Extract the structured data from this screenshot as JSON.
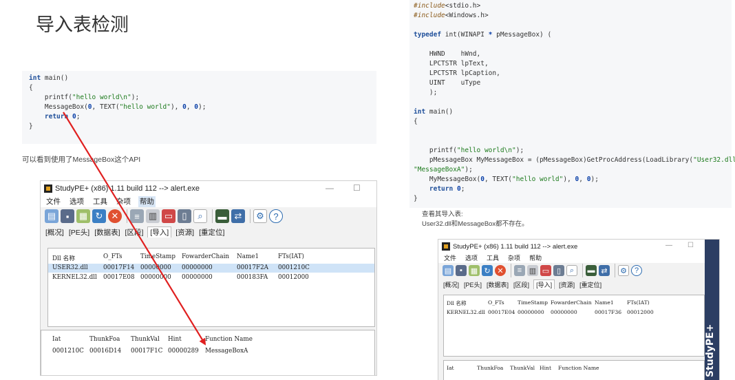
{
  "page_title": "导入表检测",
  "left_code": {
    "lines": [
      [
        {
          "t": "int",
          "c": "kw"
        },
        {
          "t": " main()",
          "c": ""
        }
      ],
      [
        {
          "t": "{",
          "c": ""
        }
      ],
      [
        {
          "t": "    printf(",
          "c": ""
        },
        {
          "t": "\"hello world\\n\"",
          "c": "str"
        },
        {
          "t": ");",
          "c": ""
        }
      ],
      [
        {
          "t": "    MessageBox(",
          "c": ""
        },
        {
          "t": "0",
          "c": "num"
        },
        {
          "t": ", TEXT(",
          "c": ""
        },
        {
          "t": "\"hello world\"",
          "c": "str"
        },
        {
          "t": "), ",
          "c": ""
        },
        {
          "t": "0",
          "c": "num"
        },
        {
          "t": ", ",
          "c": ""
        },
        {
          "t": "0",
          "c": "num"
        },
        {
          "t": ");",
          "c": ""
        }
      ],
      [
        {
          "t": "    ",
          "c": ""
        },
        {
          "t": "return",
          "c": "kw"
        },
        {
          "t": " ",
          "c": ""
        },
        {
          "t": "0",
          "c": "num"
        },
        {
          "t": ";",
          "c": ""
        }
      ],
      [
        {
          "t": "}",
          "c": ""
        }
      ]
    ]
  },
  "left_caption": "可以看到使用了MessageBox这个API",
  "right_code": {
    "lines": [
      [
        {
          "t": "#include",
          "c": "pp"
        },
        {
          "t": "<stdio.h>",
          "c": ""
        }
      ],
      [
        {
          "t": "#include",
          "c": "pp"
        },
        {
          "t": "<Windows.h>",
          "c": ""
        }
      ],
      [
        {
          "t": "",
          "c": ""
        }
      ],
      [
        {
          "t": "typedef",
          "c": "kw"
        },
        {
          "t": " int(WINAPI ",
          "c": ""
        },
        {
          "t": "*",
          "c": "num"
        },
        {
          "t": " pMessageBox) (",
          "c": ""
        }
      ],
      [
        {
          "t": "",
          "c": ""
        }
      ],
      [
        {
          "t": "    HWND    hWnd,",
          "c": ""
        }
      ],
      [
        {
          "t": "    LPCTSTR lpText,",
          "c": ""
        }
      ],
      [
        {
          "t": "    LPCTSTR lpCaption,",
          "c": ""
        }
      ],
      [
        {
          "t": "    UINT    uType",
          "c": ""
        }
      ],
      [
        {
          "t": "    );",
          "c": ""
        }
      ],
      [
        {
          "t": "",
          "c": ""
        }
      ],
      [
        {
          "t": "int",
          "c": "kw"
        },
        {
          "t": " main()",
          "c": ""
        }
      ],
      [
        {
          "t": "{",
          "c": ""
        }
      ],
      [
        {
          "t": "",
          "c": ""
        }
      ],
      [
        {
          "t": "",
          "c": ""
        }
      ],
      [
        {
          "t": "    printf(",
          "c": ""
        },
        {
          "t": "\"hello world\\n\"",
          "c": "str"
        },
        {
          "t": ");",
          "c": ""
        }
      ],
      [
        {
          "t": "    pMessageBox MyMessageBox = (pMessageBox)GetProcAddress(LoadLibrary(",
          "c": ""
        },
        {
          "t": "\"User32.dll\"",
          "c": "str"
        },
        {
          "t": "),",
          "c": ""
        }
      ],
      [
        {
          "t": "\"MessageBoxA\"",
          "c": "str"
        },
        {
          "t": ");",
          "c": ""
        }
      ],
      [
        {
          "t": "    MyMessageBox(",
          "c": ""
        },
        {
          "t": "0",
          "c": "num"
        },
        {
          "t": ", TEXT(",
          "c": ""
        },
        {
          "t": "\"hello world\"",
          "c": "str"
        },
        {
          "t": "), ",
          "c": ""
        },
        {
          "t": "0",
          "c": "num"
        },
        {
          "t": ", ",
          "c": ""
        },
        {
          "t": "0",
          "c": "num"
        },
        {
          "t": ");",
          "c": ""
        }
      ],
      [
        {
          "t": "    ",
          "c": ""
        },
        {
          "t": "return",
          "c": "kw"
        },
        {
          "t": " ",
          "c": ""
        },
        {
          "t": "0",
          "c": "num"
        },
        {
          "t": ";",
          "c": ""
        }
      ],
      [
        {
          "t": "}",
          "c": ""
        }
      ]
    ]
  },
  "right_caption_1": "查看其导入表:",
  "right_caption_2": "User32.dll和MessageBox都不存在。",
  "window1": {
    "title": "StudyPE+ (x86) 1.11 build 112  --> alert.exe",
    "menu": [
      "文件",
      "选项",
      "工具",
      "杂项",
      "帮助"
    ],
    "tabs": [
      "[概况]",
      "[PE头]",
      "[数据表]",
      "[区段]",
      "[导入]",
      "[资源]",
      "[重定位]"
    ],
    "dll_headers": [
      "Dll 名称",
      "O_FTs",
      "TimeStamp",
      "FowarderChain",
      "Name1",
      "FTs(IAT)"
    ],
    "dll_rows": [
      [
        "USER32.dll",
        "00017F14",
        "00000000",
        "00000000",
        "00017F2A",
        "0001210C"
      ],
      [
        "KERNEL32.dll",
        "00017E08",
        "00000000",
        "00000000",
        "000183FA",
        "00012000"
      ]
    ],
    "func_headers": [
      "Iat",
      "ThunkFoa",
      "ThunkVal",
      "Hint",
      "Function Name"
    ],
    "func_rows": [
      [
        "0001210C",
        "00016D14",
        "00017F1C",
        "00000289",
        "MessageBoxA"
      ]
    ]
  },
  "window2": {
    "title": "StudyPE+ (x86) 1.11 build 112  --> alert.exe",
    "menu": [
      "文件",
      "选项",
      "工具",
      "杂项",
      "帮助"
    ],
    "tabs": [
      "[概况]",
      "[PE头]",
      "[数据表]",
      "[区段]",
      "[导入]",
      "[资源]",
      "[重定位]"
    ],
    "dll_headers": [
      "Dll 名称",
      "O_FTs",
      "TimeStamp",
      "FowarderChain",
      "Name1",
      "FTs(IAT)"
    ],
    "dll_rows": [
      [
        "KERNEL32.dll",
        "00017E04",
        "00000000",
        "00000000",
        "00017F36",
        "00012000"
      ]
    ],
    "func_headers": [
      "Iat",
      "ThunkFoa",
      "ThunkVal",
      "Hint",
      "Function Name"
    ],
    "banner": "StudyPE+"
  },
  "colors": {
    "arrow": "#e02020",
    "selection": "#cfe3f7",
    "banner": "#2c3e63"
  }
}
